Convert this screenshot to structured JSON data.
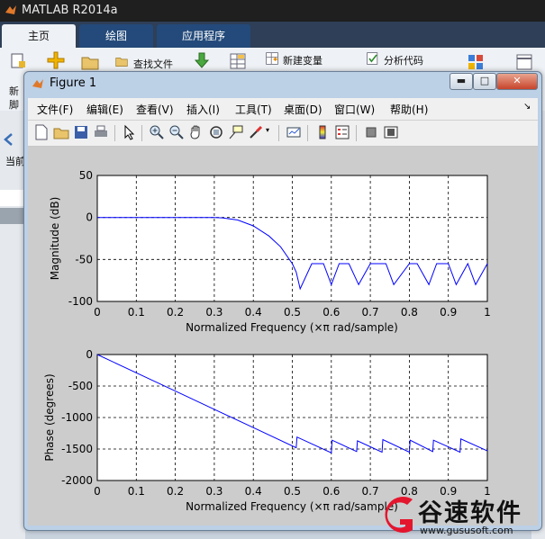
{
  "app": {
    "title": "MATLAB R2014a"
  },
  "ribbon": {
    "tabs": [
      "主页",
      "绘图",
      "应用程序"
    ],
    "items": {
      "new_variable": "新建变量",
      "analyze_code": "分析代码",
      "find_files": "查找文件",
      "new_label": "新",
      "script_label": "脚"
    }
  },
  "left_panel": {
    "current_label": "当前"
  },
  "figure": {
    "title": "Figure 1",
    "menus": [
      "文件(F)",
      "编辑(E)",
      "查看(V)",
      "插入(I)",
      "工具(T)",
      "桌面(D)",
      "窗口(W)",
      "帮助(H)"
    ],
    "toolbar_icons": [
      "new-figure-icon",
      "open-file-icon",
      "save-icon",
      "print-icon",
      "edit-plot-arrow-icon",
      "zoom-in-icon",
      "zoom-out-icon",
      "pan-hand-icon",
      "rotate-3d-icon",
      "data-cursor-icon",
      "brush-icon",
      "link-plot-icon",
      "colorbar-icon",
      "legend-icon",
      "hide-plot-tools-icon",
      "show-plot-tools-icon"
    ],
    "colors": {
      "line": "#0000ff",
      "axes_bg": "#ffffff",
      "figure_bg": "#cccccc"
    }
  },
  "chart_data": [
    {
      "type": "line",
      "title": "",
      "xlabel": "Normalized Frequency  (×π rad/sample)",
      "ylabel": "Magnitude (dB)",
      "xlim": [
        0,
        1
      ],
      "ylim": [
        -100,
        50
      ],
      "xticks": [
        "0",
        "0.1",
        "0.2",
        "0.3",
        "0.4",
        "0.5",
        "0.6",
        "0.7",
        "0.8",
        "0.9",
        "1"
      ],
      "yticks": [
        "50",
        "0",
        "-50",
        "-100"
      ],
      "grid": true,
      "x": [
        0,
        0.1,
        0.2,
        0.3,
        0.32,
        0.36,
        0.4,
        0.44,
        0.47,
        0.5,
        0.51,
        0.52,
        0.55,
        0.58,
        0.6,
        0.62,
        0.645,
        0.67,
        0.7,
        0.74,
        0.76,
        0.8,
        0.82,
        0.85,
        0.87,
        0.9,
        0.92,
        0.95,
        0.97,
        1.0
      ],
      "values": [
        0,
        0,
        0,
        0,
        -0.5,
        -3,
        -10,
        -22,
        -35,
        -55,
        -65,
        -85,
        -55,
        -55,
        -80,
        -55,
        -55,
        -80,
        -55,
        -55,
        -80,
        -55,
        -55,
        -80,
        -55,
        -55,
        -80,
        -55,
        -80,
        -55
      ]
    },
    {
      "type": "line",
      "title": "",
      "xlabel": "Normalized Frequency  (×π rad/sample)",
      "ylabel": "Phase (degrees)",
      "xlim": [
        0,
        1
      ],
      "ylim": [
        -2000,
        0
      ],
      "xticks": [
        "0",
        "0.1",
        "0.2",
        "0.3",
        "0.4",
        "0.5",
        "0.6",
        "0.7",
        "0.8",
        "0.9",
        "1"
      ],
      "yticks": [
        "0",
        "-500",
        "-1000",
        "-1500",
        "-2000"
      ],
      "grid": true,
      "x": [
        0,
        0.1,
        0.2,
        0.3,
        0.4,
        0.51,
        0.512,
        0.6,
        0.602,
        0.665,
        0.667,
        0.73,
        0.732,
        0.8,
        0.802,
        0.86,
        0.862,
        0.93,
        0.932,
        1.0
      ],
      "values": [
        0,
        -290,
        -580,
        -870,
        -1160,
        -1480,
        -1310,
        -1560,
        -1360,
        -1540,
        -1370,
        -1550,
        -1350,
        -1550,
        -1360,
        -1540,
        -1360,
        -1550,
        -1340,
        -1530
      ]
    }
  ],
  "watermark": {
    "name": "谷速软件",
    "url": "www.gususoft.com"
  }
}
